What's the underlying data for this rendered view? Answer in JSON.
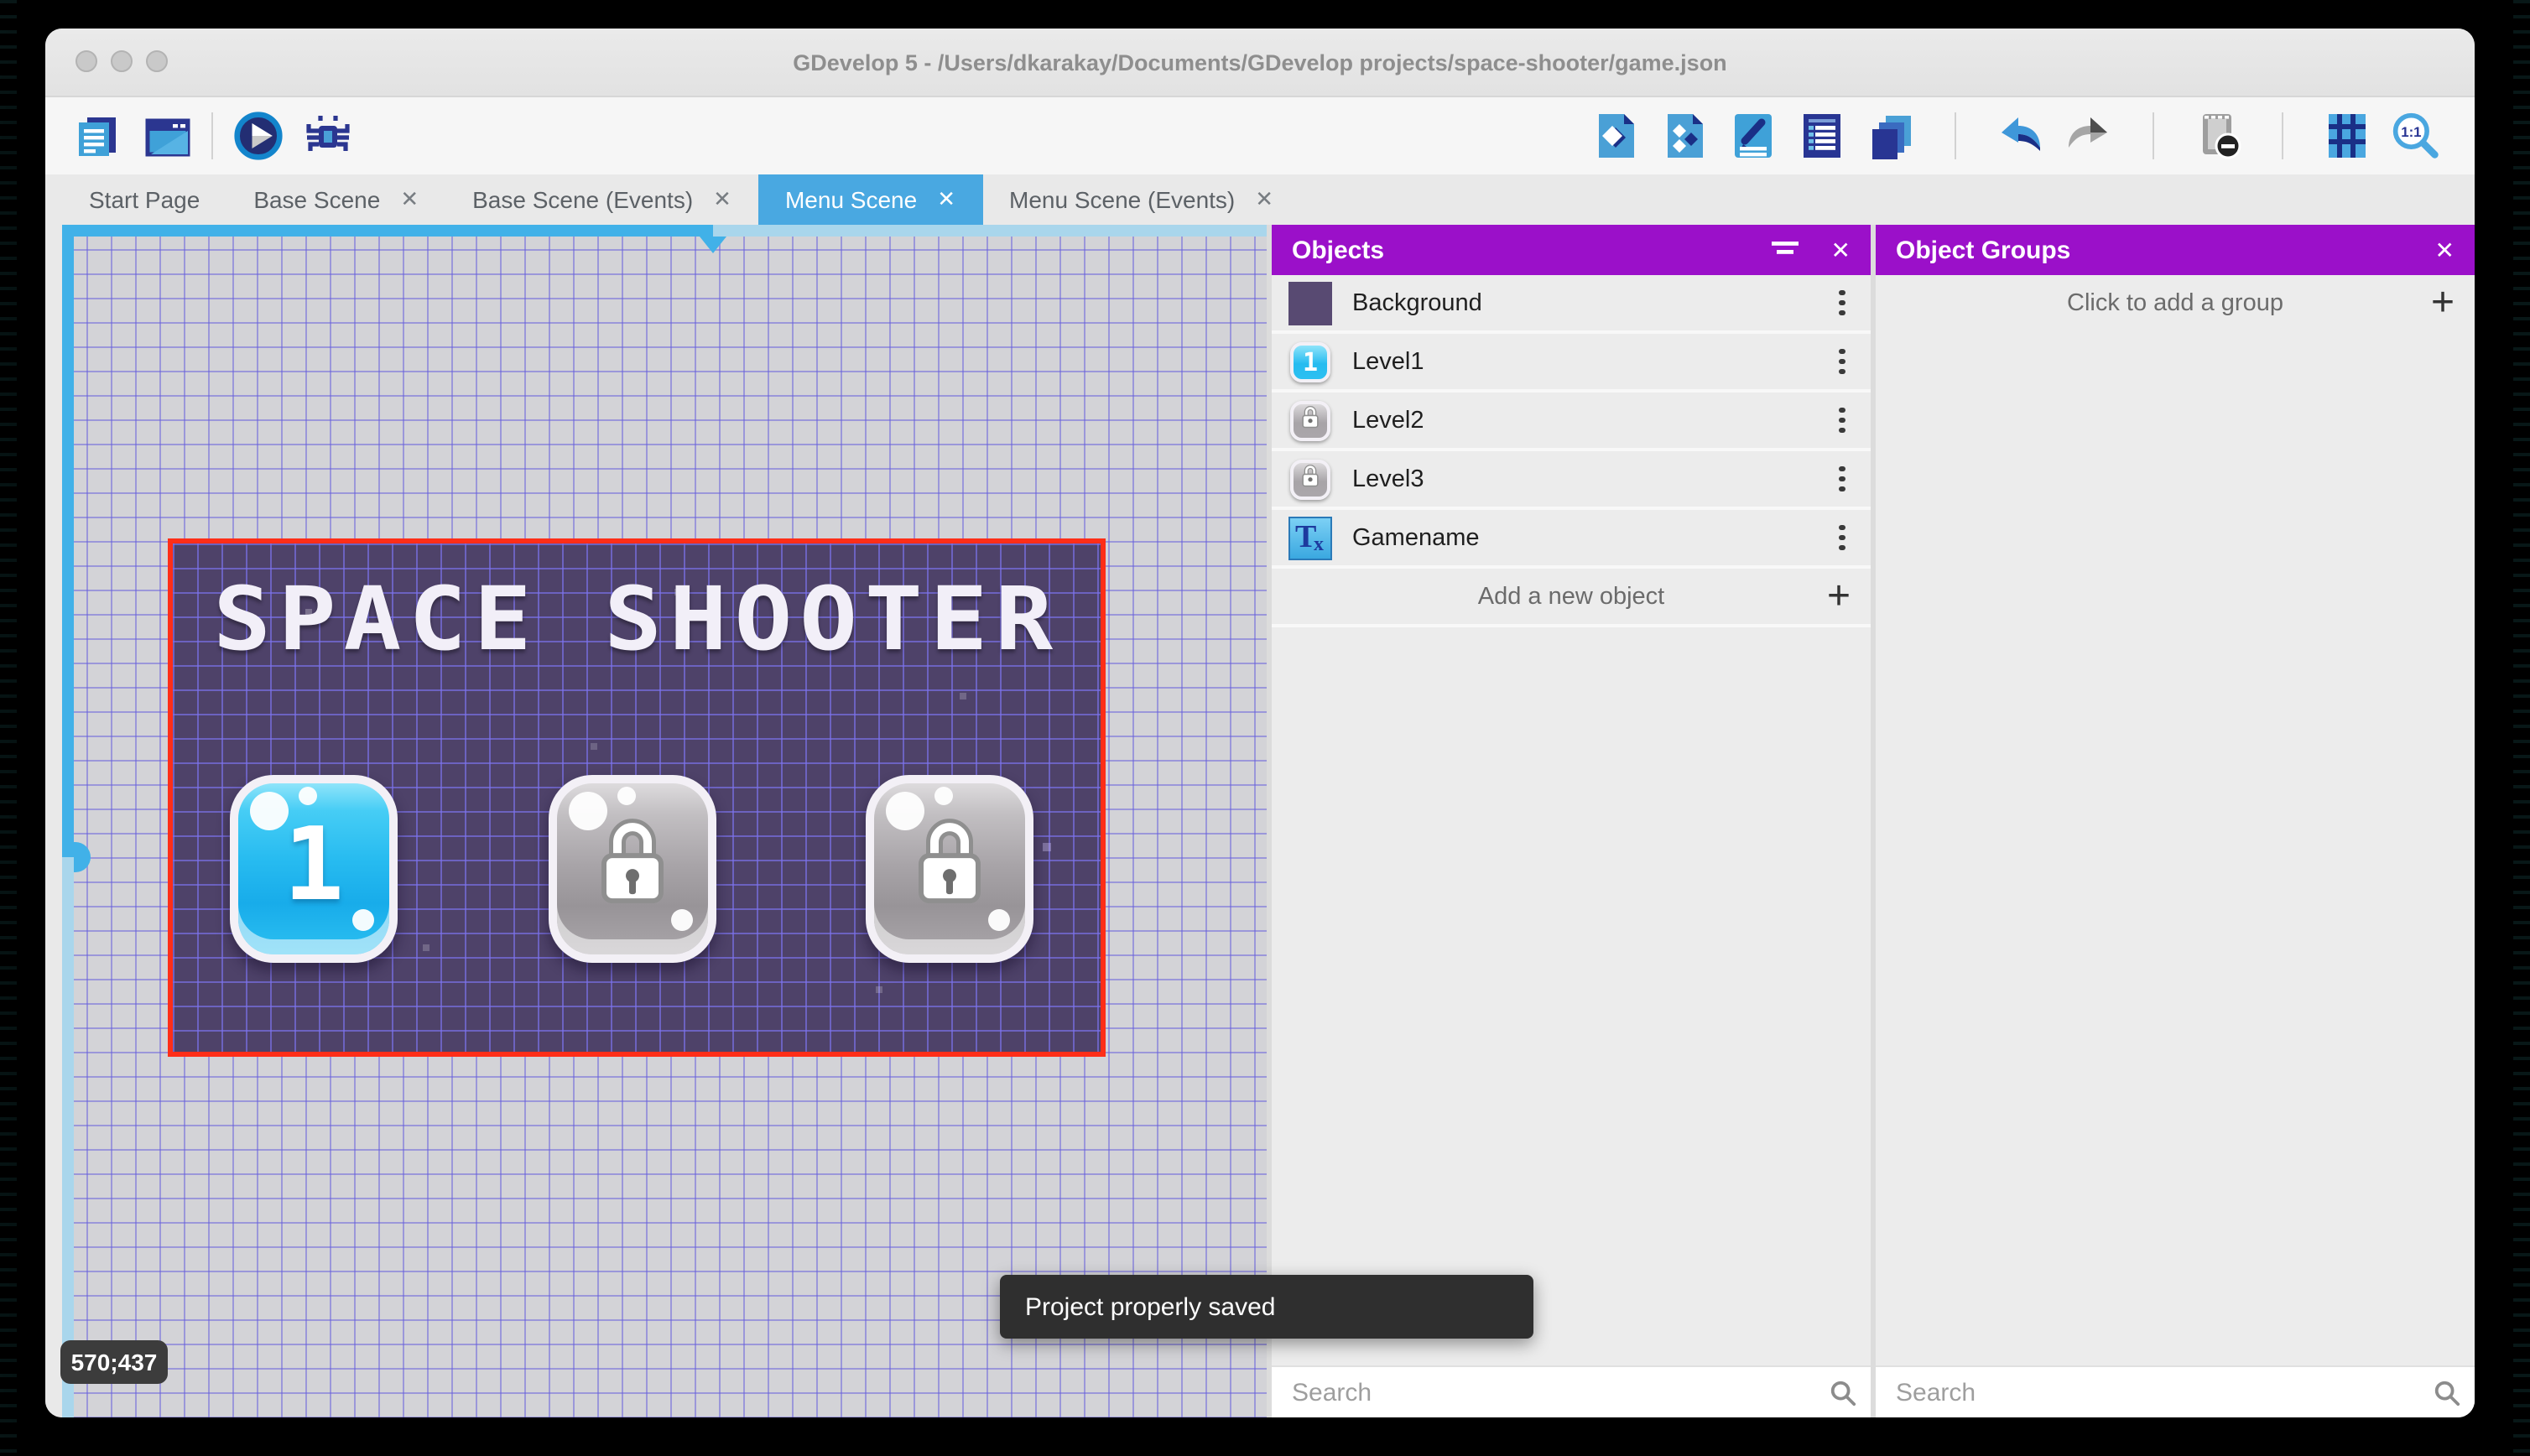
{
  "window": {
    "title": "GDevelop 5 - /Users/dkarakay/Documents/GDevelop projects/space-shooter/game.json"
  },
  "toolbar": {
    "left_icons": [
      {
        "name": "project-manager"
      },
      {
        "name": "start-page"
      },
      {
        "name": "preview-play"
      },
      {
        "name": "debug"
      }
    ],
    "right_icons": [
      {
        "name": "open-objects-editor"
      },
      {
        "name": "open-object-groups-editor"
      },
      {
        "name": "open-properties"
      },
      {
        "name": "open-instances-list"
      },
      {
        "name": "open-layers-editor"
      },
      {
        "name": "undo"
      },
      {
        "name": "redo"
      },
      {
        "name": "toggle-window-mask"
      },
      {
        "name": "toggle-grid"
      },
      {
        "name": "zoom-options"
      }
    ]
  },
  "tabs": [
    {
      "label": "Start Page",
      "active": false,
      "closable": false
    },
    {
      "label": "Base Scene",
      "active": false,
      "closable": true
    },
    {
      "label": "Base Scene (Events)",
      "active": false,
      "closable": true
    },
    {
      "label": "Menu Scene",
      "active": true,
      "closable": true
    },
    {
      "label": "Menu Scene (Events)",
      "active": false,
      "closable": true
    }
  ],
  "icons": {
    "close": "✕",
    "plus": "+"
  },
  "canvas": {
    "coordinates": "570;437",
    "scene": {
      "title": "SPACE SHOOTER",
      "buttons": [
        {
          "label": "1",
          "locked": false
        },
        {
          "label": "",
          "locked": true
        },
        {
          "label": "",
          "locked": true
        }
      ]
    }
  },
  "objects_panel": {
    "title": "Objects",
    "items": [
      {
        "name": "Background",
        "thumbnail": "purple-square"
      },
      {
        "name": "Level1",
        "thumbnail": "blue-button-1"
      },
      {
        "name": "Level2",
        "thumbnail": "gray-lock-button"
      },
      {
        "name": "Level3",
        "thumbnail": "gray-lock-button"
      },
      {
        "name": "Gamename",
        "thumbnail": "text-object"
      }
    ],
    "add_label": "Add a new object",
    "search_placeholder": "Search"
  },
  "object_groups_panel": {
    "title": "Object Groups",
    "empty_label": "Click to add a group",
    "search_placeholder": "Search"
  },
  "toast": {
    "message": "Project properly saved"
  },
  "colors": {
    "panel_header": "#9b10c9",
    "active_tab": "#49a8e1",
    "selection_border": "#fe2e18",
    "scene_background": "#4e4269",
    "grid_line": "#645cdc",
    "scrollbar": "#41b1e8",
    "toast_background": "#2f2f2f"
  }
}
